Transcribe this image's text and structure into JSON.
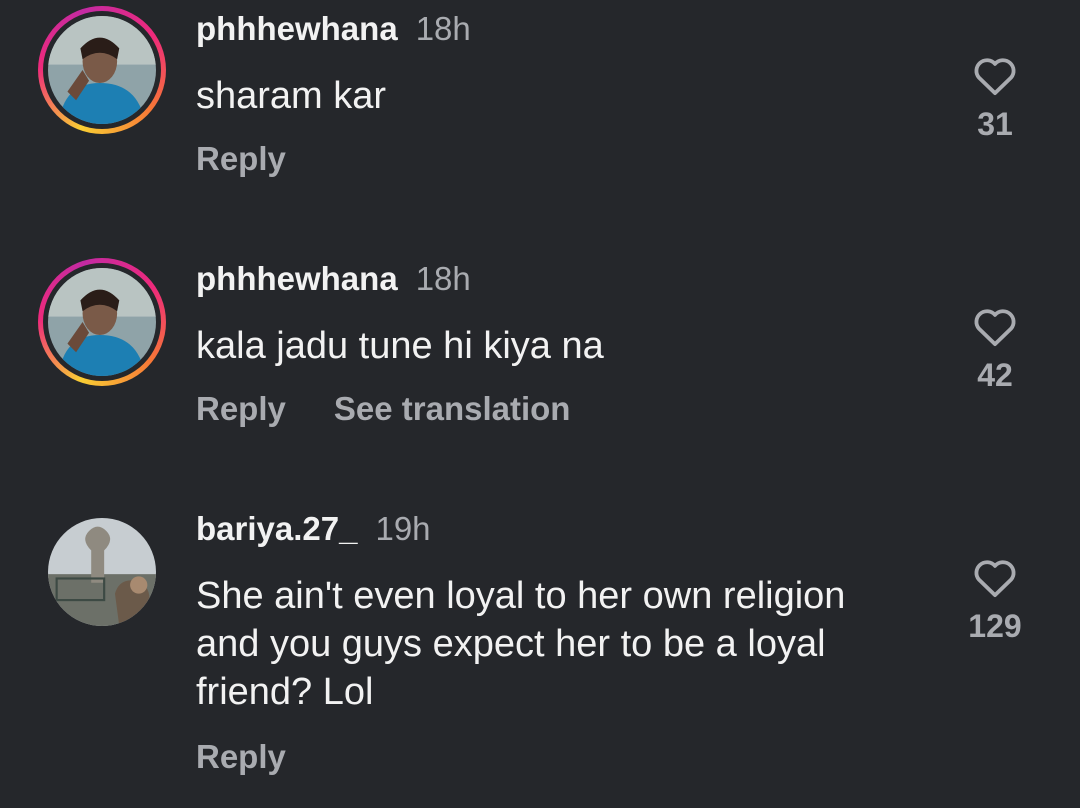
{
  "comments": [
    {
      "username": "phhhewhana",
      "time": "18h",
      "text": "sharam kar",
      "actions": [
        "Reply"
      ],
      "likes": "31",
      "avatar_story_ring": true
    },
    {
      "username": "phhhewhana",
      "time": "18h",
      "text": "kala jadu tune hi kiya na",
      "actions": [
        "Reply",
        "See translation"
      ],
      "likes": "42",
      "avatar_story_ring": true
    },
    {
      "username": "bariya.27_",
      "time": "19h",
      "text": "She ain't even loyal to her own religion and you guys expect her to be a loyal friend? Lol",
      "actions": [
        "Reply"
      ],
      "likes": "129",
      "avatar_story_ring": false
    }
  ],
  "colors": {
    "background": "#25272b",
    "primary_text": "#f2f2f2",
    "secondary_text": "#a9abb0"
  },
  "icons": {
    "like": "heart-outline-icon"
  }
}
